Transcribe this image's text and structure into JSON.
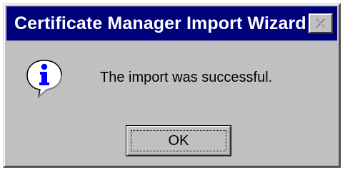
{
  "window": {
    "title": "Certificate Manager Import Wizard",
    "close_icon": "close-icon"
  },
  "message": {
    "icon": "info-icon",
    "text": "The import was successful."
  },
  "buttons": {
    "ok_label": "OK"
  },
  "colors": {
    "titlebar": "#00007b",
    "dialog_bg": "#c0c0c0",
    "title_text": "#ffffff",
    "info_blue": "#0000ff"
  }
}
